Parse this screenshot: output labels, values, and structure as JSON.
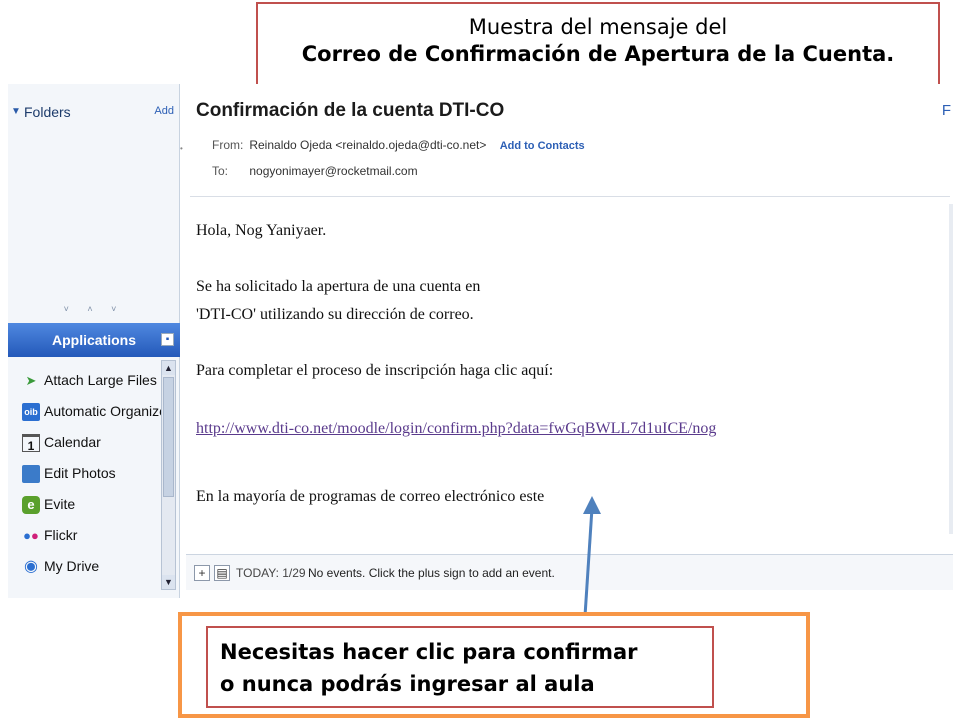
{
  "title_box": {
    "line1": "Muestra del mensaje del",
    "line2": "Correo de Confirmación de Apertura de la Cuenta."
  },
  "sidebar": {
    "folders_label": "Folders",
    "folders_add": "Add",
    "splitter_glyphs": "˅ ˄ ˅",
    "applications_label": "Applications",
    "apps": [
      {
        "label": "Attach Large Files",
        "icon": "paper-plane-icon",
        "glyph": "➤",
        "color": "#3a9a3a"
      },
      {
        "label": "Automatic Organizer",
        "icon": "oib-logo-icon",
        "glyph": "oib",
        "color": "#2b6fd1"
      },
      {
        "label": "Calendar",
        "icon": "calendar-icon",
        "glyph": "1",
        "color": "#333333"
      },
      {
        "label": "Edit Photos",
        "icon": "photo-icon",
        "glyph": "▣",
        "color": "#3b7bc9"
      },
      {
        "label": "Evite",
        "icon": "evite-icon",
        "glyph": "e",
        "color": "#5aa02c"
      },
      {
        "label": "Flickr",
        "icon": "flickr-icon",
        "glyph": "●●",
        "color": "#d0207a"
      },
      {
        "label": "My Drive",
        "icon": "drive-icon",
        "glyph": "◉",
        "color": "#2b6fd1"
      }
    ]
  },
  "message": {
    "subject": "Confirmación de la cuenta DTI-CO",
    "corner_label": "F",
    "from_label": "From:",
    "from_value": "Reinaldo Ojeda <reinaldo.ojeda@dti-co.net>",
    "add_to_contacts": "Add to Contacts",
    "to_label": "To:",
    "to_value": "nogyonimayer@rocketmail.com",
    "body": {
      "greeting": "Hola, Nog Yaniyaer.",
      "line1": "Se ha solicitado la apertura de una cuenta en",
      "line2": "'DTI-CO' utilizando su dirección de correo.",
      "line3": "Para completar el proceso de inscripción haga clic aquí:",
      "link": "http://www.dti-co.net/moodle/login/confirm.php?data=fwGqBWLL7d1uICE/nog",
      "line4": "En la mayoría de programas de correo electrónico este"
    }
  },
  "events_bar": {
    "today": "TODAY: 1/29",
    "text": "No events. Click the plus sign to add an event."
  },
  "callout": {
    "line1": "Necesitas hacer clic para confirmar",
    "line2": "o nunca podrás ingresar al aula"
  },
  "colors": {
    "title_border": "#c0504d",
    "callout_outer_border": "#f79646",
    "callout_inner_border": "#c0504d",
    "arrow": "#4f81bd",
    "link": "#5a3a8c",
    "apps_header": "#2459b9"
  }
}
